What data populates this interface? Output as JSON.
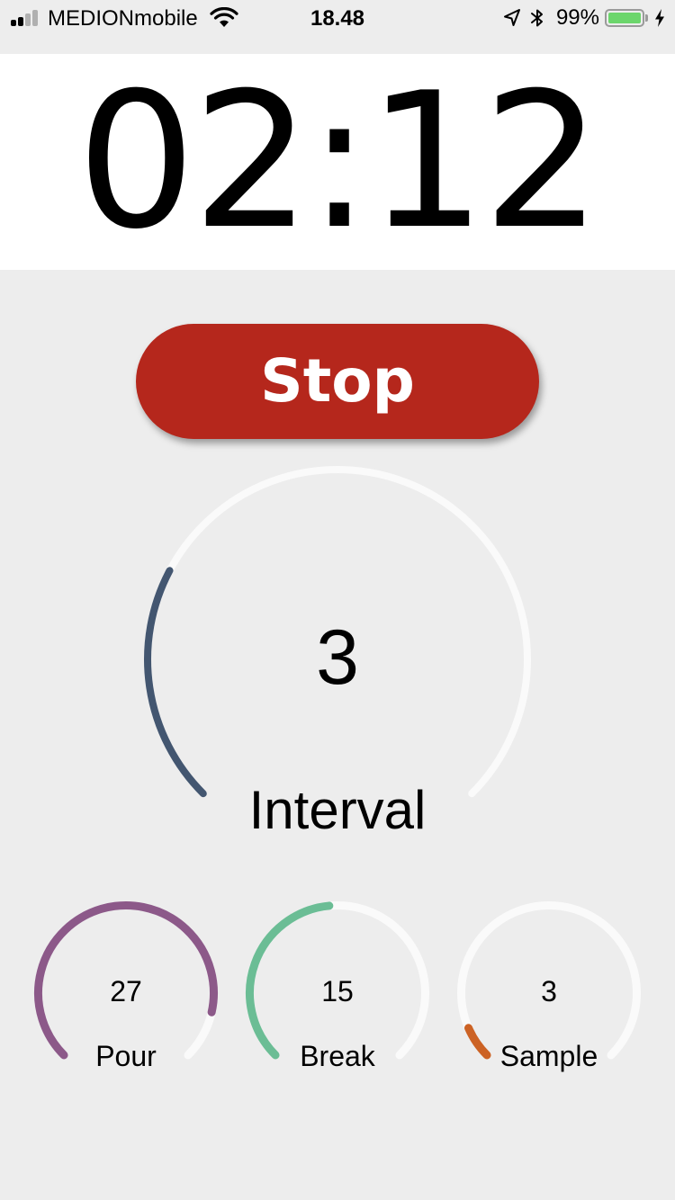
{
  "status_bar": {
    "carrier": "MEDIONmobile",
    "time": "18.48",
    "battery_percent": "99%",
    "battery_level": 0.99,
    "signal_bars_active": 2,
    "signal_bars_total": 4,
    "icons": [
      "signal-icon",
      "wifi-icon",
      "location-arrow-icon",
      "bluetooth-icon",
      "battery-icon",
      "charging-bolt-icon"
    ]
  },
  "timer": {
    "display": "02:12"
  },
  "controls": {
    "stop_label": "Stop",
    "stop_color": "#b5271c"
  },
  "main_gauge": {
    "value": "3",
    "label": "Interval",
    "progress": 0.27,
    "color": "#435670",
    "track_color": "#fafafa"
  },
  "small_gauges": [
    {
      "value": "27",
      "label": "Pour",
      "progress": 0.88,
      "color": "#8c5989"
    },
    {
      "value": "15",
      "label": "Break",
      "progress": 0.48,
      "color": "#6bbd95"
    },
    {
      "value": "3",
      "label": "Sample",
      "progress": 0.08,
      "color": "#cc6224"
    }
  ]
}
